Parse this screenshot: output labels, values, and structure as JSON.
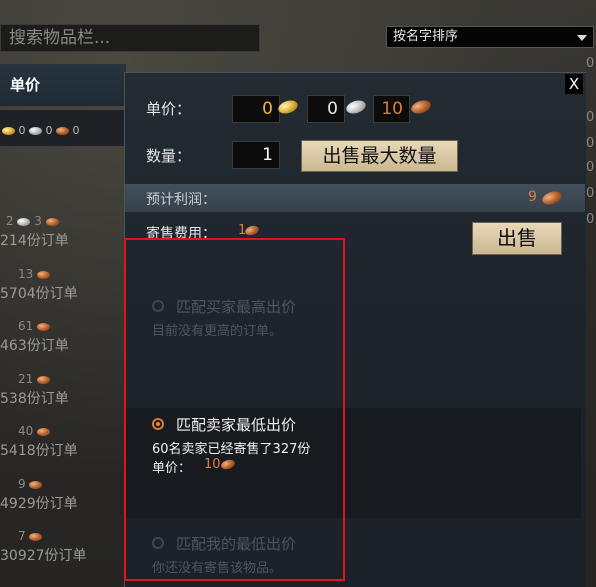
{
  "search": {
    "placeholder": "搜索物品栏..."
  },
  "sort": {
    "selected": "按名字排序"
  },
  "left_list": {
    "header": "单价",
    "first_row_values": [
      "0",
      "0",
      "0"
    ],
    "items": [
      {
        "price": "2",
        "price2": "3",
        "orders": "214份订单"
      },
      {
        "price": "13",
        "orders": "5704份订单"
      },
      {
        "price": "61",
        "orders": "463份订单"
      },
      {
        "price": "21",
        "orders": "538份订单"
      },
      {
        "price": "40",
        "orders": "5418份订单"
      },
      {
        "price": "9",
        "orders": "4929份订单"
      },
      {
        "price": "7",
        "orders": "30927份订单"
      }
    ],
    "right_edge_values": [
      "0",
      "0",
      "0",
      "0",
      "0",
      "0"
    ]
  },
  "dialog": {
    "close_label": "X",
    "unit_price_label": "单价：",
    "gold_value": "0",
    "silver_value": "0",
    "copper_value": "10",
    "quantity_label": "数量：",
    "quantity_value": "1",
    "max_quantity_button": "出售最大数量",
    "profit_label": "预计利润：",
    "profit_value": "9",
    "fee_label": "寄售费用：",
    "fee_value": "1",
    "sell_button": "出售",
    "options": [
      {
        "title": "匹配买家最高出价",
        "subtitle": "目前没有更高的订单。",
        "selected": false
      },
      {
        "title": "匹配卖家最低出价",
        "subtitle": "60名卖家已经寄售了327份",
        "unit_price_label": "单价：",
        "unit_price_value": "10",
        "selected": true
      },
      {
        "title": "匹配我的最低出价",
        "subtitle": "你还没有寄售该物品。",
        "selected": false
      }
    ]
  },
  "colors": {
    "highlight_box": "#e0141c",
    "gold": "#f0b43a",
    "copper": "#e07a3a",
    "button_tan": "#d8c7a2"
  }
}
